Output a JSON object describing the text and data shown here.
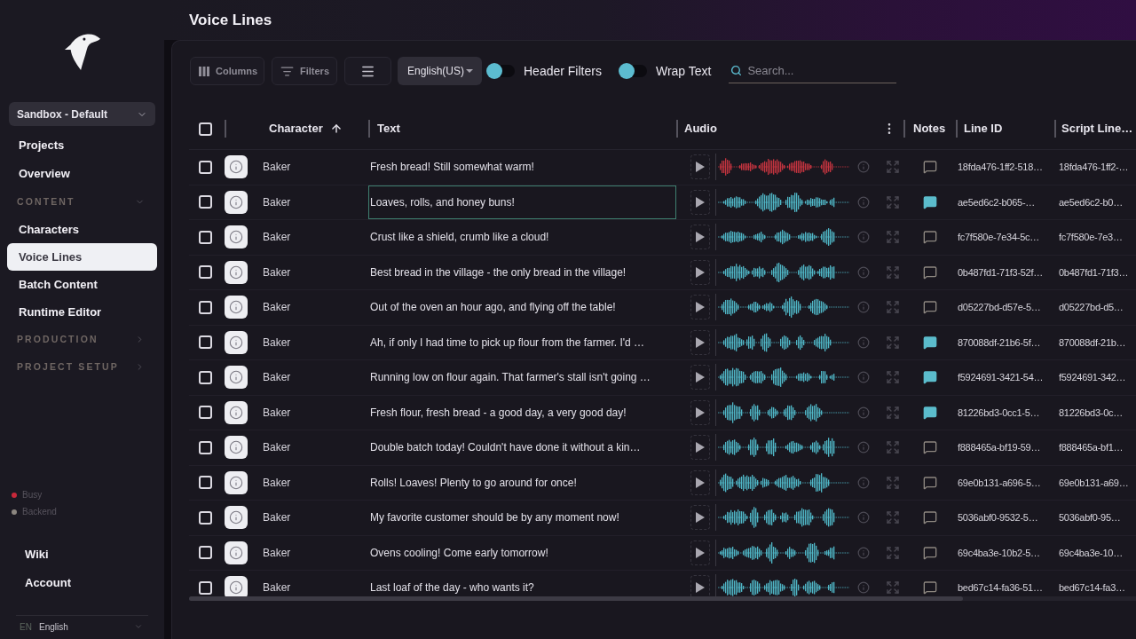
{
  "sidebar": {
    "workspace": "Sandbox - Default",
    "nav": [
      {
        "kind": "link",
        "label": "Projects",
        "selected": false
      },
      {
        "kind": "link",
        "label": "Overview",
        "selected": false
      },
      {
        "kind": "section",
        "label": "CONTENT",
        "expanded": true,
        "children": [
          {
            "label": "Characters",
            "selected": false
          },
          {
            "label": "Voice Lines",
            "selected": true
          },
          {
            "label": "Batch Content",
            "selected": false
          },
          {
            "label": "Runtime Editor",
            "selected": false
          }
        ]
      },
      {
        "kind": "section",
        "label": "PRODUCTION",
        "expanded": false
      },
      {
        "kind": "section",
        "label": "PROJECT SETUP",
        "expanded": false
      }
    ],
    "status": [
      {
        "label": "Busy",
        "color": "#c8283a"
      },
      {
        "label": "Backend",
        "color": "#8c8680"
      }
    ],
    "footer_links": [
      {
        "label": "Wiki"
      },
      {
        "label": "Account"
      }
    ],
    "language": {
      "code": "EN",
      "label": "English"
    }
  },
  "page": {
    "title": "Voice Lines"
  },
  "toolbar": {
    "columns_button": "Columns",
    "filters_button": "Filters",
    "language_select": "English(US)",
    "toggles": [
      {
        "label": "Header Filters",
        "on": false
      },
      {
        "label": "Wrap Text",
        "on": false
      }
    ],
    "search": {
      "placeholder": "Search..."
    }
  },
  "table": {
    "select_all": {
      "checked": false
    },
    "columns": [
      {
        "label": "Character",
        "sorted": true
      },
      {
        "label": "Text"
      },
      {
        "label": "Audio"
      },
      {
        "label": "Notes"
      },
      {
        "label": "Line ID"
      },
      {
        "label": "Script Line…"
      }
    ],
    "rows": [
      {
        "checked": false,
        "character": "Baker",
        "text": "Fresh bread! Still somewhat warm!",
        "text_focused": false,
        "playing": true,
        "has_notes": false,
        "line_id": "18fda476-1ff2-518…",
        "script_line": "18fda476-1ff2-…"
      },
      {
        "checked": false,
        "character": "Baker",
        "text": "Loaves, rolls, and honey buns!",
        "text_focused": true,
        "playing": false,
        "has_notes": true,
        "line_id": "ae5ed6c2-b065-…",
        "script_line": "ae5ed6c2-b0…"
      },
      {
        "checked": false,
        "character": "Baker",
        "text": "Crust like a shield, crumb like a cloud!",
        "text_focused": false,
        "playing": false,
        "has_notes": false,
        "line_id": "fc7f580e-7e34-5c…",
        "script_line": "fc7f580e-7e3…"
      },
      {
        "checked": false,
        "character": "Baker",
        "text": "Best bread in the village - the only bread in the village!",
        "text_focused": false,
        "playing": false,
        "has_notes": false,
        "line_id": "0b487fd1-71f3-52f…",
        "script_line": "0b487fd1-71f3…"
      },
      {
        "checked": false,
        "character": "Baker",
        "text": "Out of the oven an hour ago, and flying off the table!",
        "text_focused": false,
        "playing": false,
        "has_notes": false,
        "line_id": "d05227bd-d57e-5…",
        "script_line": "d05227bd-d5…"
      },
      {
        "checked": false,
        "character": "Baker",
        "text": "Ah, if only I had time to pick up flour from the farmer. I'd …",
        "text_focused": false,
        "playing": false,
        "has_notes": true,
        "line_id": "870088df-21b6-5f…",
        "script_line": "870088df-21b…"
      },
      {
        "checked": false,
        "character": "Baker",
        "text": "Running low on flour again. That farmer's stall isn't going …",
        "text_focused": false,
        "playing": false,
        "has_notes": true,
        "line_id": "f5924691-3421-54…",
        "script_line": "f5924691-342…"
      },
      {
        "checked": false,
        "character": "Baker",
        "text": "Fresh flour, fresh bread - a good day, a very good day!",
        "text_focused": false,
        "playing": false,
        "has_notes": true,
        "line_id": "81226bd3-0cc1-5…",
        "script_line": "81226bd3-0c…"
      },
      {
        "checked": false,
        "character": "Baker",
        "text": "Double batch today! Couldn't have done it without a kin…",
        "text_focused": false,
        "playing": false,
        "has_notes": false,
        "line_id": "f888465a-bf19-59…",
        "script_line": "f888465a-bf1…"
      },
      {
        "checked": false,
        "character": "Baker",
        "text": "Rolls! Loaves! Plenty to go around for once!",
        "text_focused": false,
        "playing": false,
        "has_notes": false,
        "line_id": "69e0b131-a696-5…",
        "script_line": "69e0b131-a69…"
      },
      {
        "checked": false,
        "character": "Baker",
        "text": "My favorite customer should be by any moment now!",
        "text_focused": false,
        "playing": false,
        "has_notes": false,
        "line_id": "5036abf0-9532-5…",
        "script_line": "5036abf0-95…"
      },
      {
        "checked": false,
        "character": "Baker",
        "text": "Ovens cooling! Come early tomorrow!",
        "text_focused": false,
        "playing": false,
        "has_notes": false,
        "line_id": "69c4ba3e-10b2-5…",
        "script_line": "69c4ba3e-10…"
      },
      {
        "checked": false,
        "character": "Baker",
        "text": "Last loaf of the day - who wants it?",
        "text_focused": false,
        "playing": false,
        "has_notes": false,
        "line_id": "bed67c14-fa36-51…",
        "script_line": "bed67c14-fa3…"
      }
    ]
  }
}
